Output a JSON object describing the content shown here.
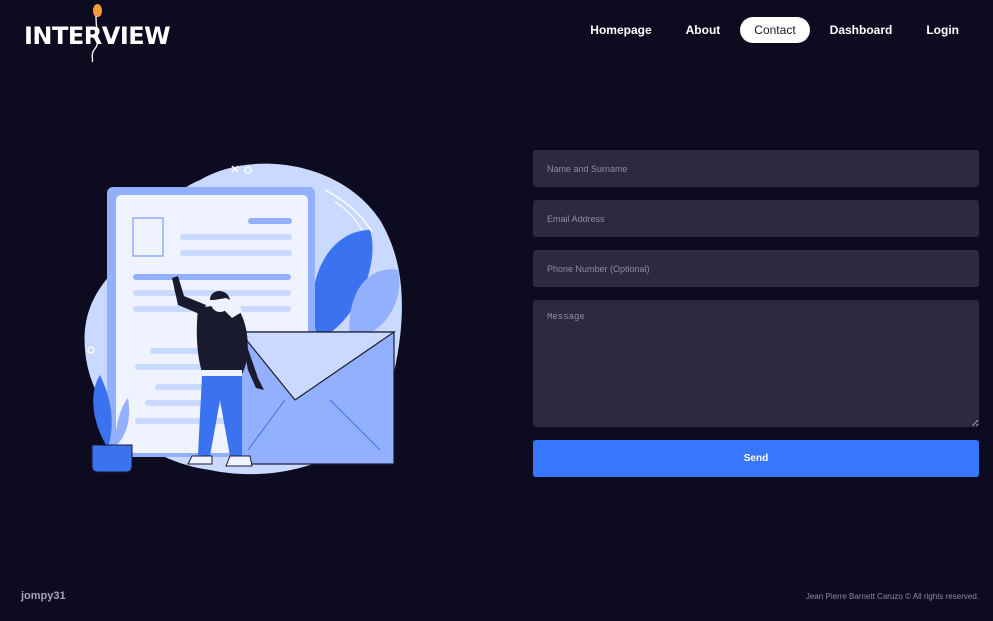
{
  "brand": {
    "logo_text": "INTERVIEW"
  },
  "nav": {
    "items": [
      {
        "label": "Homepage",
        "active": false
      },
      {
        "label": "About",
        "active": false
      },
      {
        "label": "Contact",
        "active": true
      },
      {
        "label": "Dashboard",
        "active": false
      },
      {
        "label": "Login",
        "active": false
      }
    ]
  },
  "illustration": {
    "icon": "contact-envelope-illustration"
  },
  "form": {
    "name": {
      "placeholder": "Name and Surname",
      "value": ""
    },
    "email": {
      "placeholder": "Email Address",
      "value": ""
    },
    "phone": {
      "placeholder": "Phone Number (Optional)",
      "value": ""
    },
    "message": {
      "placeholder": "Message",
      "value": ""
    },
    "send_label": "Send"
  },
  "footer": {
    "username": "jompy31",
    "copyright": "Jean Pierre Barnett Caruzo © All rights reserved."
  },
  "colors": {
    "background": "#0d0b20",
    "input_bg": "#2b2a3f",
    "accent": "#3777ff",
    "illustration_light": "#c9d9ff",
    "illustration_mid": "#93b0ff",
    "illustration_blue": "#3a72f0"
  }
}
